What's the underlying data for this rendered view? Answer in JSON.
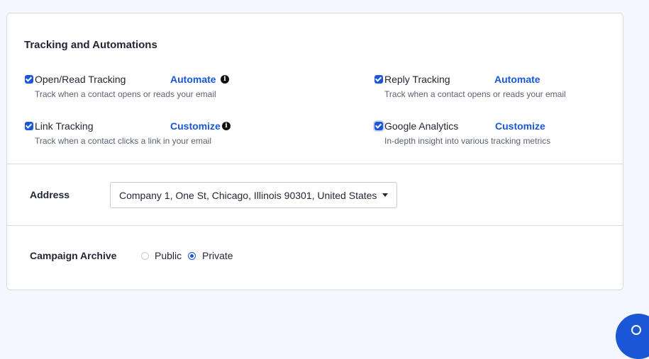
{
  "tracking": {
    "title": "Tracking and Automations",
    "items": [
      {
        "label": "Open/Read Tracking",
        "description": "Track when a contact opens or reads your email",
        "link": "Automate",
        "checked": true,
        "info": true
      },
      {
        "label": "Reply Tracking",
        "description": "Track when a contact opens or reads your email",
        "link": "Automate",
        "checked": true,
        "info": false
      },
      {
        "label": "Link Tracking",
        "description": "Track when a contact clicks a link in your email",
        "link": "Customize",
        "checked": true,
        "info": true
      },
      {
        "label": "Google Analytics",
        "description": "In-depth insight into various tracking metrics",
        "link": "Customize",
        "checked": true,
        "info": false
      }
    ]
  },
  "address": {
    "label": "Address",
    "selected": "Company 1, One St, Chicago, Illinois 90301, United States"
  },
  "archive": {
    "label": "Campaign Archive",
    "options": [
      "Public",
      "Private"
    ],
    "selected": "Private"
  },
  "colors": {
    "accent": "#1a57d6",
    "background": "#f4f7fd"
  },
  "icons": {
    "info": "info-circle-icon",
    "chat": "chat-icon"
  }
}
